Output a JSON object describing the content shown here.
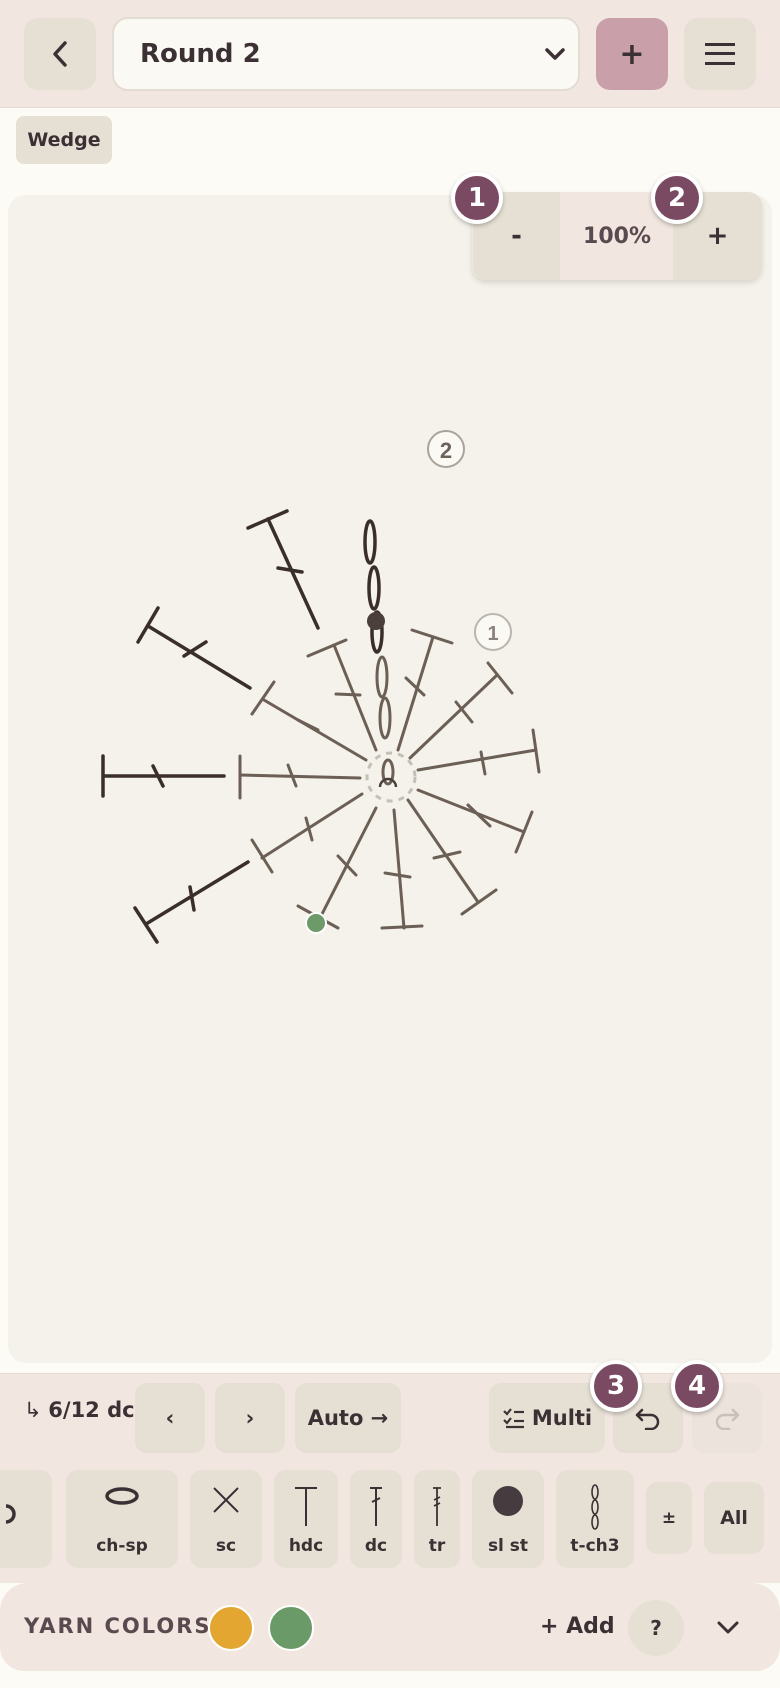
{
  "header": {
    "back_icon": "chevron-left-icon",
    "round_select_value": "Round 2",
    "add_round_label": "+",
    "menu_icon": "hamburger-icon"
  },
  "mode_chip": "Wedge",
  "zoom": {
    "out_label": "-",
    "level": "100%",
    "in_label": "+"
  },
  "badges": [
    "1",
    "2",
    "3",
    "4"
  ],
  "chart_round_markers": [
    "1",
    "2"
  ],
  "toolbar": {
    "progress": "6/12 dc",
    "prev_label": "‹",
    "next_label": "›",
    "auto_label": "Auto →",
    "multi_label": "Multi",
    "undo_icon": "undo-icon",
    "redo_icon": "redo-icon"
  },
  "stitches": [
    {
      "label": "ch-sp",
      "icon": "oval-icon"
    },
    {
      "label": "sc",
      "icon": "x-icon"
    },
    {
      "label": "hdc",
      "icon": "t-icon"
    },
    {
      "label": "dc",
      "icon": "dc-icon"
    },
    {
      "label": "tr",
      "icon": "tr-icon"
    },
    {
      "label": "sl st",
      "icon": "dot-icon"
    },
    {
      "label": "t-ch3",
      "icon": "chain-icon"
    },
    {
      "label": "±"
    },
    {
      "label": "All"
    }
  ],
  "yarn": {
    "title": "YARN COLORS",
    "colors": [
      "#e2a631",
      "#6a9a68"
    ],
    "add_label": "+ Add",
    "help_label": "?",
    "collapse_icon": "chevron-down-icon"
  }
}
